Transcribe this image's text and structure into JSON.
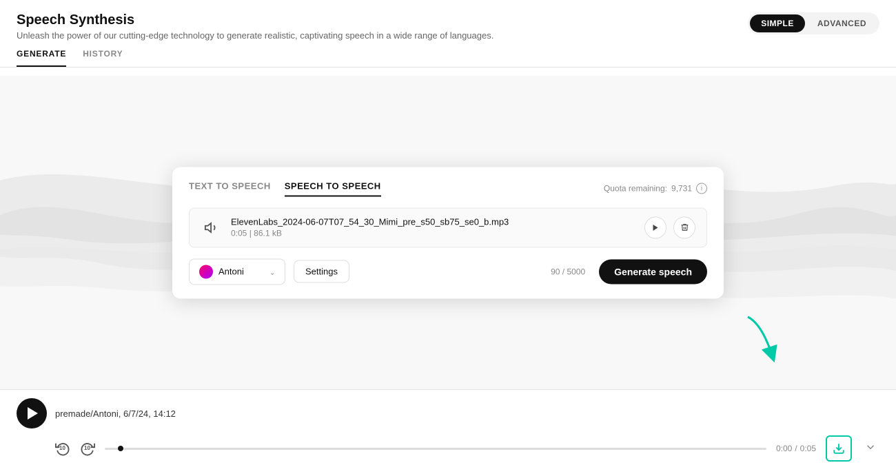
{
  "header": {
    "title": "Speech Synthesis",
    "subtitle": "Unleash the power of our cutting-edge technology to generate realistic, captivating speech in a wide range of languages.",
    "mode_simple": "SIMPLE",
    "mode_advanced": "ADVANCED"
  },
  "tabs": {
    "generate": "GENERATE",
    "history": "HISTORY"
  },
  "modal": {
    "tab_text_to_speech": "TEXT TO SPEECH",
    "tab_speech_to_speech": "SPEECH TO SPEECH",
    "quota_label": "Quota remaining:",
    "quota_value": "9,731",
    "file": {
      "name": "ElevenLabs_2024-06-07T07_54_30_Mimi_pre_s50_sb75_se0_b.mp3",
      "duration": "0:05",
      "size": "86.1 kB"
    },
    "voice_name": "Antoni",
    "settings_label": "Settings",
    "char_count": "90 / 5000",
    "generate_label": "Generate speech"
  },
  "player": {
    "track_info": "premade/Antoni, 6/7/24, 14:12",
    "current_time": "0:00",
    "separator": "/",
    "total_time": "0:05"
  }
}
